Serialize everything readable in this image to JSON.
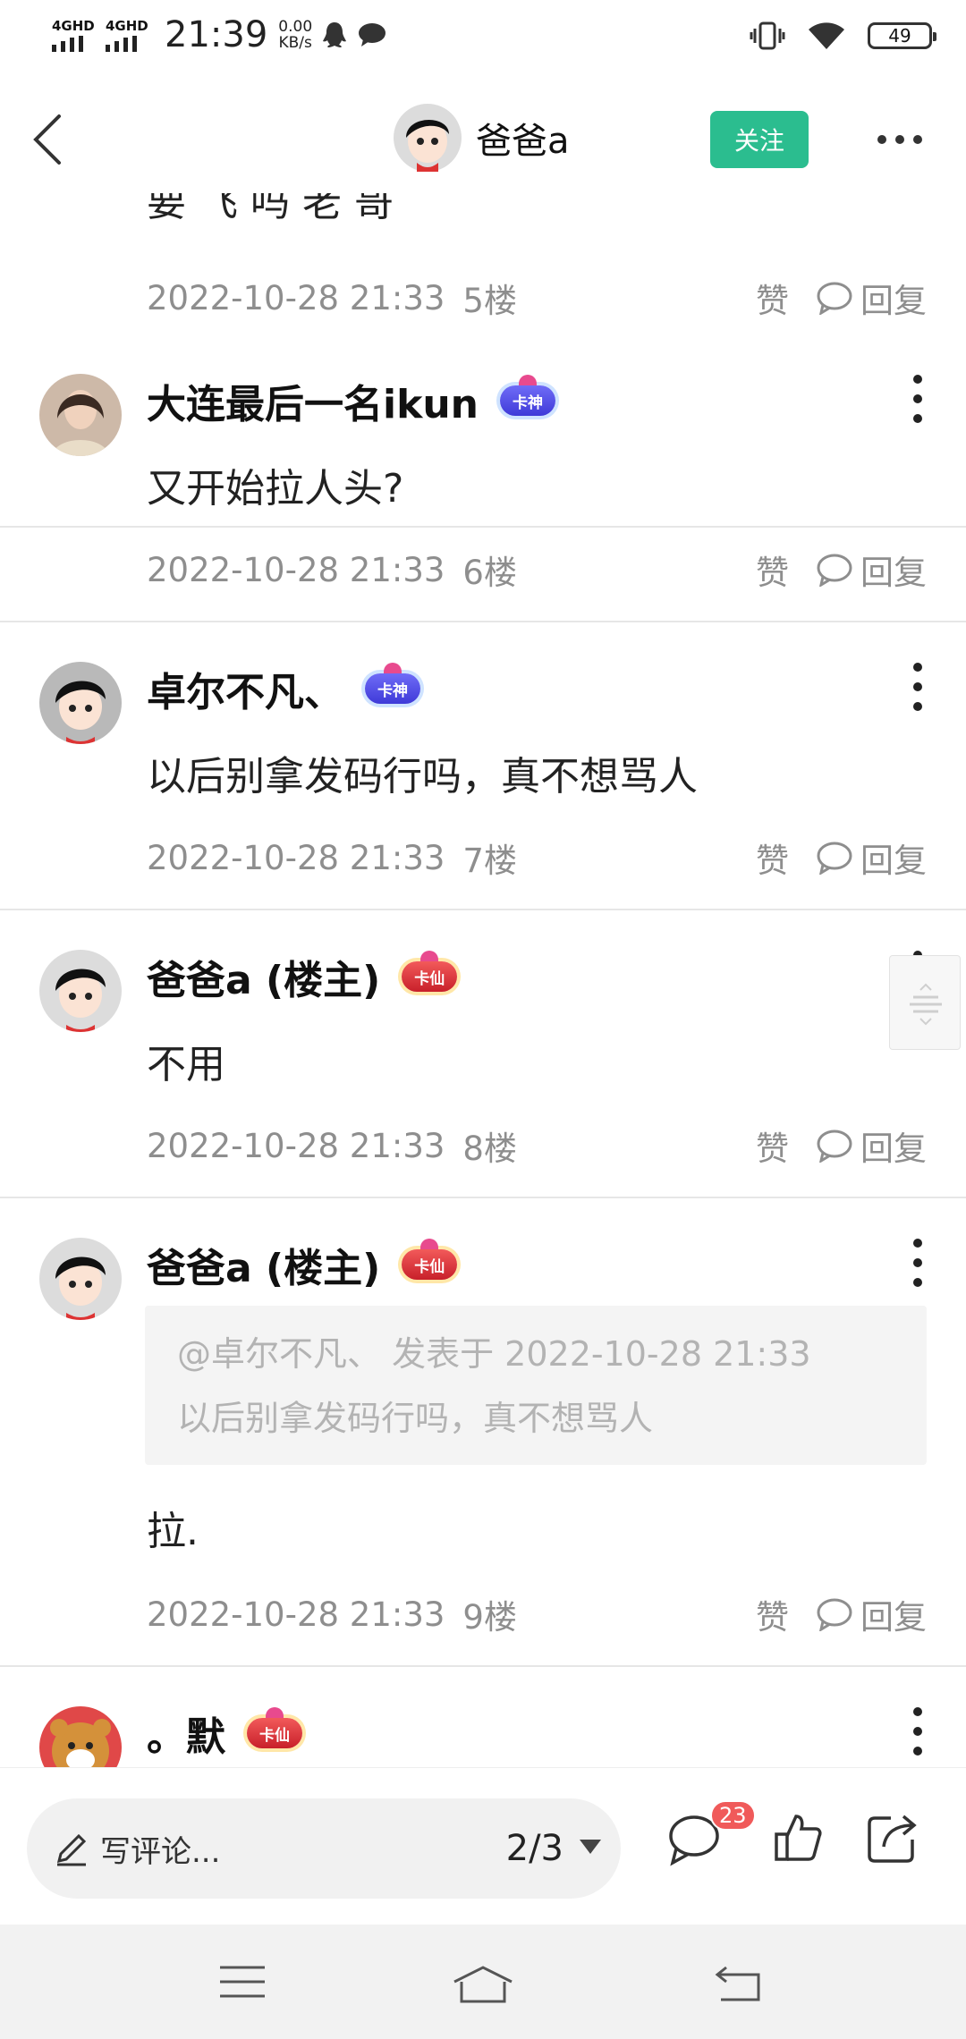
{
  "status_bar": {
    "net1": "4GHD",
    "net2": "4GHD",
    "time": "21:39",
    "speed_value": "0.00",
    "speed_unit": "KB/s",
    "battery": "49"
  },
  "header": {
    "username": "爸爸a",
    "follow_label": "关注"
  },
  "posts": [
    {
      "partial_text": "要 飞 吗 老 哥",
      "date": "2022-10-28 21:33",
      "floor": "5楼",
      "like_label": "赞",
      "reply_label": "回复"
    },
    {
      "name": "大连最后一名ikun",
      "badge": "卡神",
      "text": "又开始拉人头?",
      "date": "2022-10-28 21:33",
      "floor": "6楼",
      "like_label": "赞",
      "reply_label": "回复"
    },
    {
      "name": "卓尔不凡、",
      "badge": "卡神",
      "text": "以后别拿发码行吗，真不想骂人",
      "date": "2022-10-28 21:33",
      "floor": "7楼",
      "like_label": "赞",
      "reply_label": "回复"
    },
    {
      "name": "爸爸a (楼主)",
      "badge": "卡仙",
      "text": "不用",
      "date": "2022-10-28 21:33",
      "floor": "8楼",
      "like_label": "赞",
      "reply_label": "回复"
    },
    {
      "name": "爸爸a (楼主)",
      "badge": "卡仙",
      "quote_header": "@卓尔不凡、 发表于 2022-10-28 21:33",
      "quote_text": "以后别拿发码行吗，真不想骂人",
      "text": "拉.",
      "date": "2022-10-28 21:33",
      "floor": "9楼",
      "like_label": "赞",
      "reply_label": "回复"
    },
    {
      "name": "。默",
      "badge": "卡仙"
    }
  ],
  "bottom_bar": {
    "comment_placeholder": "写评论...",
    "page_indicator": "2/3",
    "comment_count": "23"
  },
  "colors": {
    "accent": "#2bbd8f",
    "badge_red": "#f05a5a",
    "meta_gray": "#8e8e8e"
  }
}
